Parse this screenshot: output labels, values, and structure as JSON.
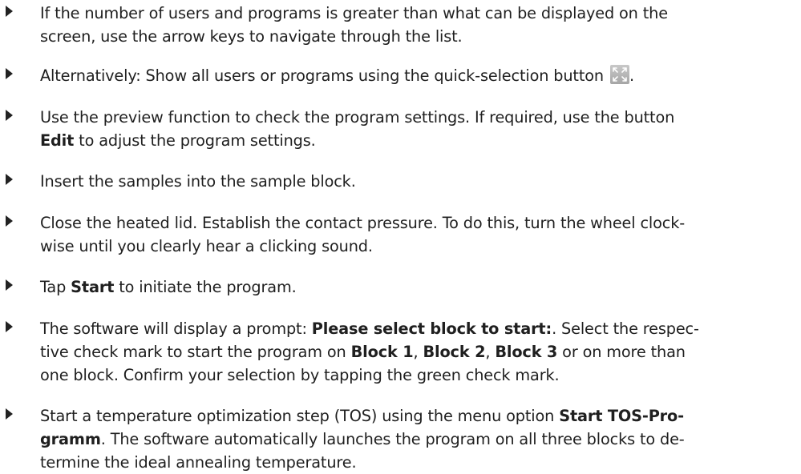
{
  "steps": [
    {
      "lines": [
        [
          {
            "t": "If the number of users and programs is greater than what can be displayed on the"
          }
        ],
        [
          {
            "t": "screen, use the arrow keys to navigate through the list."
          }
        ]
      ]
    },
    {
      "lines": [
        [
          {
            "t": "Alternatively: Show all users or programs using the quick-selection button "
          },
          {
            "icon": "quick-selection-icon"
          },
          {
            "t": "."
          }
        ]
      ]
    },
    {
      "lines": [
        [
          {
            "t": "Use the preview function to check the program settings. If required, use the button"
          }
        ],
        [
          {
            "t": "Edit",
            "b": true
          },
          {
            "t": " to adjust the program settings."
          }
        ]
      ]
    },
    {
      "lines": [
        [
          {
            "t": "Insert the samples into the sample block."
          }
        ]
      ]
    },
    {
      "lines": [
        [
          {
            "t": "Close the heated lid. Establish the contact pressure. To do this, turn the wheel clock-"
          }
        ],
        [
          {
            "t": "wise until you clearly hear a clicking sound."
          }
        ]
      ]
    },
    {
      "lines": [
        [
          {
            "t": "Tap "
          },
          {
            "t": "Start",
            "b": true
          },
          {
            "t": " to initiate the program."
          }
        ]
      ]
    },
    {
      "lines": [
        [
          {
            "t": "The software will display a prompt: "
          },
          {
            "t": "Please select block to start:",
            "b": true
          },
          {
            "t": ". Select the respec-"
          }
        ],
        [
          {
            "t": "tive check mark to start the program on "
          },
          {
            "t": "Block 1",
            "b": true
          },
          {
            "t": ", "
          },
          {
            "t": "Block 2",
            "b": true
          },
          {
            "t": ", "
          },
          {
            "t": "Block 3",
            "b": true
          },
          {
            "t": " or on more than"
          }
        ],
        [
          {
            "t": "one block. Confirm your selection by tapping the green check mark."
          }
        ]
      ]
    },
    {
      "lines": [
        [
          {
            "t": "Start a temperature optimization step (TOS) using the menu option "
          },
          {
            "t": "Start TOS-Pro-",
            "b": true
          }
        ],
        [
          {
            "t": "gramm",
            "b": true
          },
          {
            "t": ". The software automatically launches the program on all three blocks to de-"
          }
        ],
        [
          {
            "t": "termine the ideal annealing temperature."
          }
        ]
      ]
    }
  ]
}
